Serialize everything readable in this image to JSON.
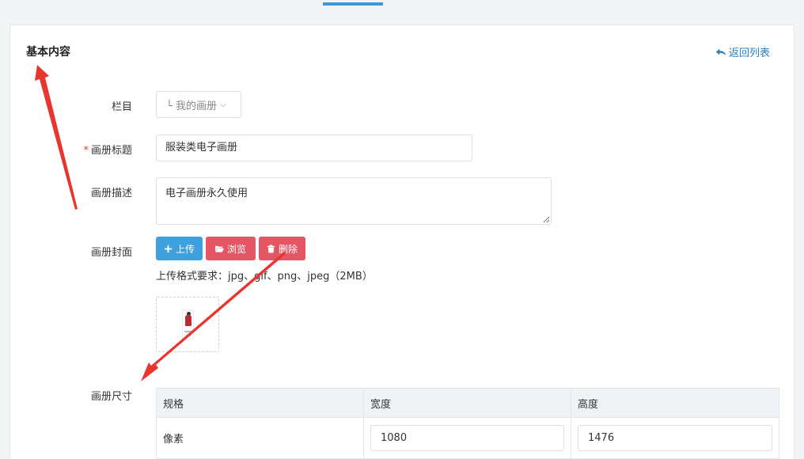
{
  "card": {
    "title": "基本内容",
    "back_link": "返回列表"
  },
  "form": {
    "column": {
      "label": "栏目",
      "value": "└ 我的画册"
    },
    "album_title": {
      "required_mark": "*",
      "label": "画册标题",
      "value": "服装类电子画册"
    },
    "album_desc": {
      "label": "画册描述",
      "value": "电子画册永久使用"
    },
    "cover": {
      "label": "画册封面",
      "upload": "上传",
      "browse": "浏览",
      "delete": "删除",
      "hint": "上传格式要求：jpg、gif、png、jpeg（2MB）"
    },
    "size": {
      "label": "画册尺寸",
      "headers": [
        "规格",
        "宽度",
        "高度"
      ],
      "rows": [
        {
          "spec": "像素",
          "width": "1080",
          "height": "1476"
        }
      ]
    }
  },
  "colors": {
    "accent": "#3ea1dd",
    "danger": "#e45664",
    "link": "#2a7fbf",
    "annotation_arrow": "#e8352f"
  },
  "icons": [
    "reply-icon",
    "plus-icon",
    "folder-open-icon",
    "trash-icon",
    "chevron-down-icon"
  ]
}
